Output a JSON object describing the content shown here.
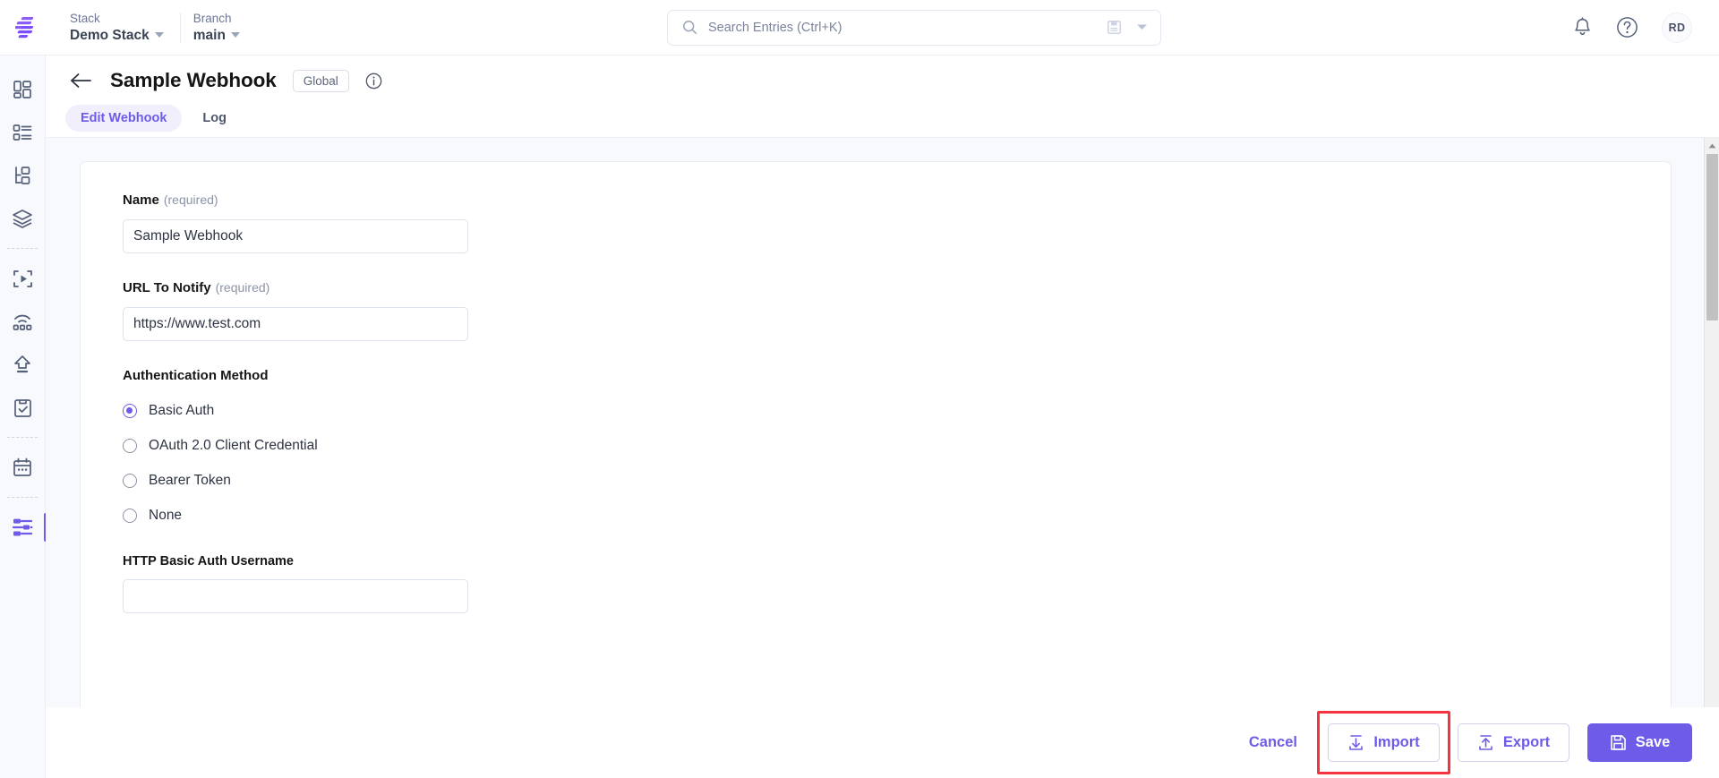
{
  "brand": {
    "logo_name": "contentstack-logo",
    "accent": "#6c5ce7"
  },
  "topbar": {
    "stack": {
      "label": "Stack",
      "value": "Demo Stack"
    },
    "branch": {
      "label": "Branch",
      "value": "main"
    },
    "search": {
      "placeholder": "Search Entries (Ctrl+K)",
      "value": ""
    },
    "notifications_icon": "bell-icon",
    "help_icon": "help-circle-icon",
    "avatar_initials": "RD"
  },
  "sidebar": {
    "items": [
      {
        "name": "dashboard",
        "icon": "dashboard-grid-icon",
        "active": false
      },
      {
        "name": "content-types",
        "icon": "content-list-icon",
        "active": false
      },
      {
        "name": "taxonomy",
        "icon": "hierarchy-tree-icon",
        "active": false
      },
      {
        "name": "assets",
        "icon": "layers-stack-icon",
        "active": false
      },
      {
        "name": "live-preview",
        "icon": "play-frame-icon",
        "active": false
      },
      {
        "name": "releases",
        "icon": "broadcast-dots-icon",
        "active": false
      },
      {
        "name": "publish-queue",
        "icon": "upload-arrow-icon",
        "active": false
      },
      {
        "name": "audit-log",
        "icon": "clipboard-check-icon",
        "active": false
      },
      {
        "name": "schedule",
        "icon": "calendar-icon",
        "active": false
      },
      {
        "name": "settings",
        "icon": "sliders-settings-icon",
        "active": true
      }
    ]
  },
  "page": {
    "back_icon": "arrow-left-icon",
    "title": "Sample Webhook",
    "scope_badge": "Global",
    "info_icon": "info-circle-icon",
    "tabs": [
      {
        "label": "Edit Webhook",
        "active": true
      },
      {
        "label": "Log",
        "active": false
      }
    ]
  },
  "form": {
    "name_field": {
      "label": "Name",
      "required_hint": "(required)",
      "value": "Sample Webhook",
      "placeholder": ""
    },
    "url_field": {
      "label": "URL To Notify",
      "required_hint": "(required)",
      "value": "https://www.test.com",
      "placeholder": ""
    },
    "auth_section": {
      "label": "Authentication Method",
      "options": [
        {
          "label": "Basic Auth",
          "selected": true
        },
        {
          "label": "OAuth 2.0 Client Credential",
          "selected": false
        },
        {
          "label": "Bearer Token",
          "selected": false
        },
        {
          "label": "None",
          "selected": false
        }
      ]
    },
    "basic_auth_username": {
      "label": "HTTP Basic Auth Username",
      "value": "",
      "placeholder": ""
    }
  },
  "footer": {
    "cancel_label": "Cancel",
    "import_label": "Import",
    "import_icon": "download-import-icon",
    "import_highlighted": true,
    "highlight_color": "#f5333f",
    "export_label": "Export",
    "export_icon": "upload-export-icon",
    "save_label": "Save",
    "save_icon": "floppy-save-icon"
  }
}
